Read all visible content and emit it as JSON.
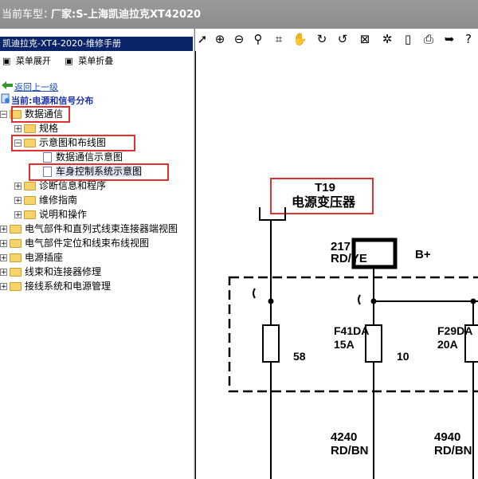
{
  "titlebar": {
    "prefix": "当前车型：",
    "model": "厂家:S-上海凯迪拉克XT42020"
  },
  "app_header": "凯迪拉克-XT4-2020-维修手册",
  "menu": {
    "expand": "菜单展开",
    "collapse": "菜单折叠"
  },
  "back_link": "返回上一级",
  "current": "当前:电源和信号分布",
  "tree": {
    "data_comm": "数据通信",
    "spec": "规格",
    "diagrams": "示意图和布线图",
    "data_comm_diagram": "数据通信示意图",
    "body_control_diagram": "车身控制系统示意图",
    "diag_info": "诊断信息和程序",
    "repair_guide": "维修指南",
    "desc_ops": "说明和操作",
    "components_inline": "电气部件和直列式线束连接器端视图",
    "components_location": "电气部件定位和线束布线视图",
    "power_outlet": "电源插座",
    "harness_repair": "线束和连接器修理",
    "ground_power": "接线系统和电源管理"
  },
  "toolbar_icons": [
    "pointer-icon",
    "zoom-in-icon",
    "zoom-out-icon",
    "magnify-icon",
    "crop-icon",
    "hand-icon",
    "rotate-cw-icon",
    "rotate-ccw-icon",
    "fit-icon",
    "settings-icon",
    "page-icon",
    "print-icon",
    "export-icon",
    "help-icon"
  ],
  "schematic": {
    "connector_id": "T19",
    "connector_name": "电源变压器",
    "wire_top_num": "217",
    "wire_top_color": "RD/YE",
    "b_plus": "B+",
    "fuse1_pin": "58",
    "fuse2_name": "F41DA",
    "fuse2_rating": "15A",
    "fuse2_pin": "10",
    "fuse3_name": "F29DA",
    "fuse3_rating": "20A",
    "wire1_num": "4240",
    "wire1_color": "RD/BN",
    "wire2_num": "4940",
    "wire2_color": "RD/BN"
  },
  "colors": {
    "highlight_box": "#e03030",
    "header_bg": "#0a246a",
    "titlebar_bg": "#8c8c8c"
  }
}
